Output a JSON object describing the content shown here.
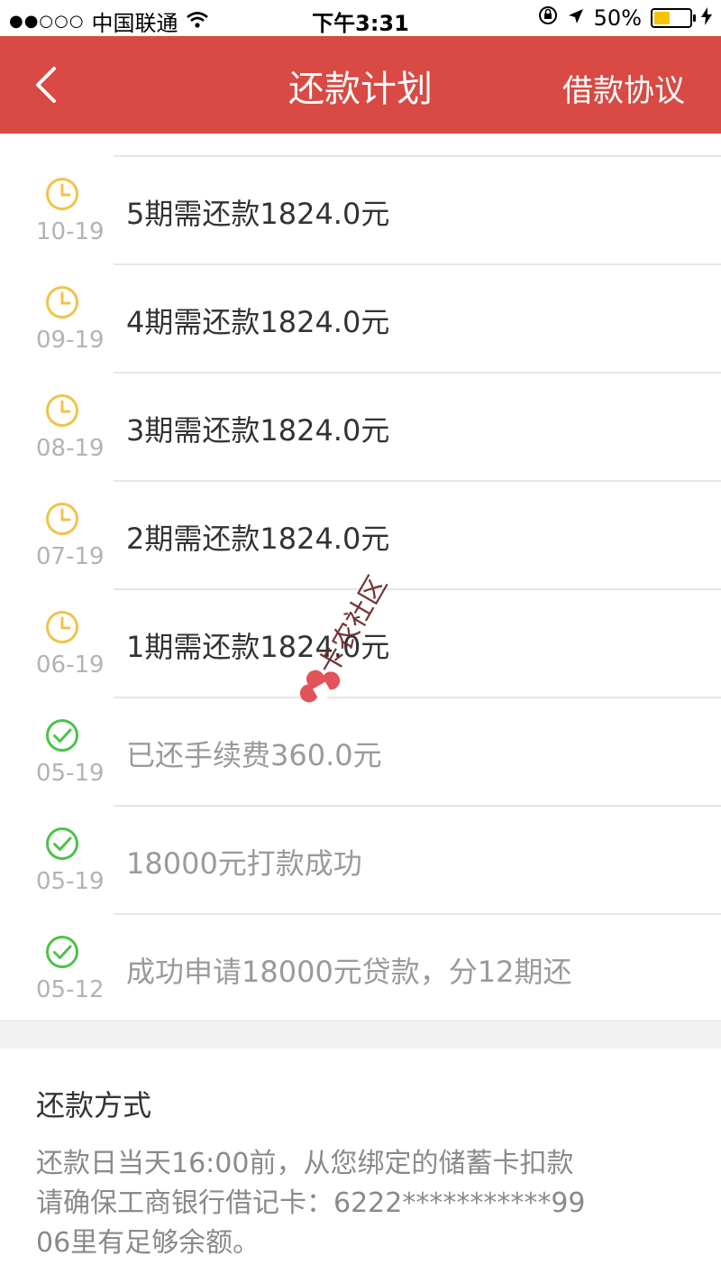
{
  "status_bar": {
    "carrier": "中国联通",
    "signal_dots": "●●○○○",
    "time": "下午3:31",
    "battery": "50%",
    "battery_level": 0.5
  },
  "nav": {
    "back_icon": "chevron-left-icon",
    "title": "还款计划",
    "right_link": "借款协议"
  },
  "timeline": [
    {
      "date": "10-19",
      "text": "5期需还款1824.0元",
      "status": "pending",
      "icon": "clock-icon",
      "color": "#f2c24b"
    },
    {
      "date": "09-19",
      "text": "4期需还款1824.0元",
      "status": "pending",
      "icon": "clock-icon",
      "color": "#f2c24b"
    },
    {
      "date": "08-19",
      "text": "3期需还款1824.0元",
      "status": "pending",
      "icon": "clock-icon",
      "color": "#f2c24b"
    },
    {
      "date": "07-19",
      "text": "2期需还款1824.0元",
      "status": "pending",
      "icon": "clock-icon",
      "color": "#f2c24b"
    },
    {
      "date": "06-19",
      "text": "1期需还款1824.0元",
      "status": "pending",
      "icon": "clock-icon",
      "color": "#f2c24b"
    },
    {
      "date": "05-19",
      "text": "已还手续费360.0元",
      "status": "done",
      "icon": "check-circle-icon",
      "color": "#4cc24a"
    },
    {
      "date": "05-19",
      "text": "18000元打款成功",
      "status": "done",
      "icon": "check-circle-icon",
      "color": "#4cc24a"
    },
    {
      "date": "05-12",
      "text": "成功申请18000元贷款，分12期还",
      "status": "done",
      "icon": "check-circle-icon",
      "color": "#4cc24a"
    }
  ],
  "repayment": {
    "title": "还款方式",
    "description": "还款日当天16:00前，从您绑定的储蓄卡扣款\n请确保工商银行借记卡：6222***********99\n06里有足够余额。"
  },
  "watermark": {
    "text": "卡农社区"
  },
  "colors": {
    "brand": "#d84a43",
    "pending": "#f2c24b",
    "done": "#4cc24a"
  }
}
